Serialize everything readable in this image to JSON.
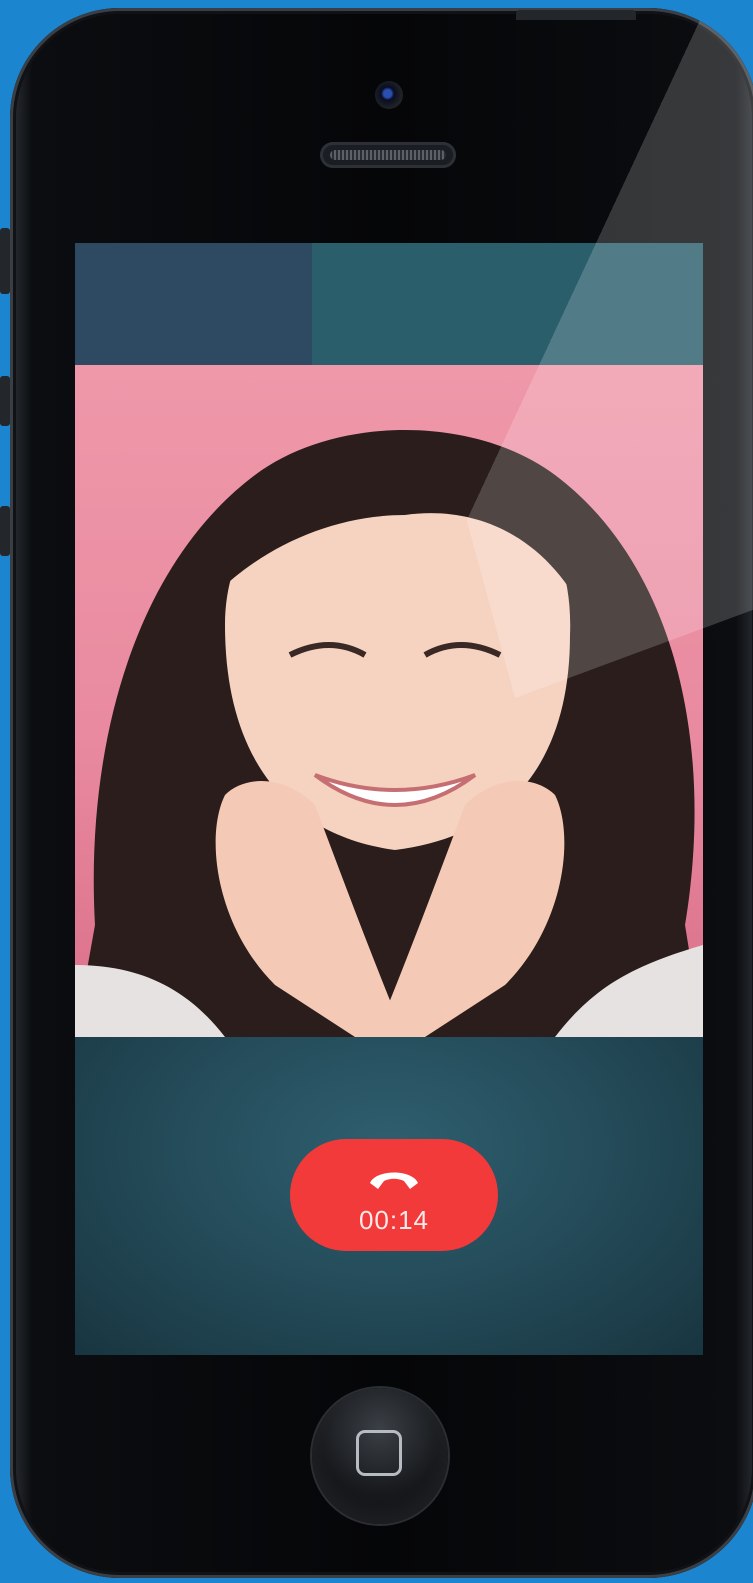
{
  "call": {
    "timer": "00:14",
    "end_call_color": "#f23a3a",
    "icon": "end-call-phone-icon"
  },
  "device": {
    "home_button_icon": "home-square-icon",
    "background_color": "#1b86cf"
  }
}
